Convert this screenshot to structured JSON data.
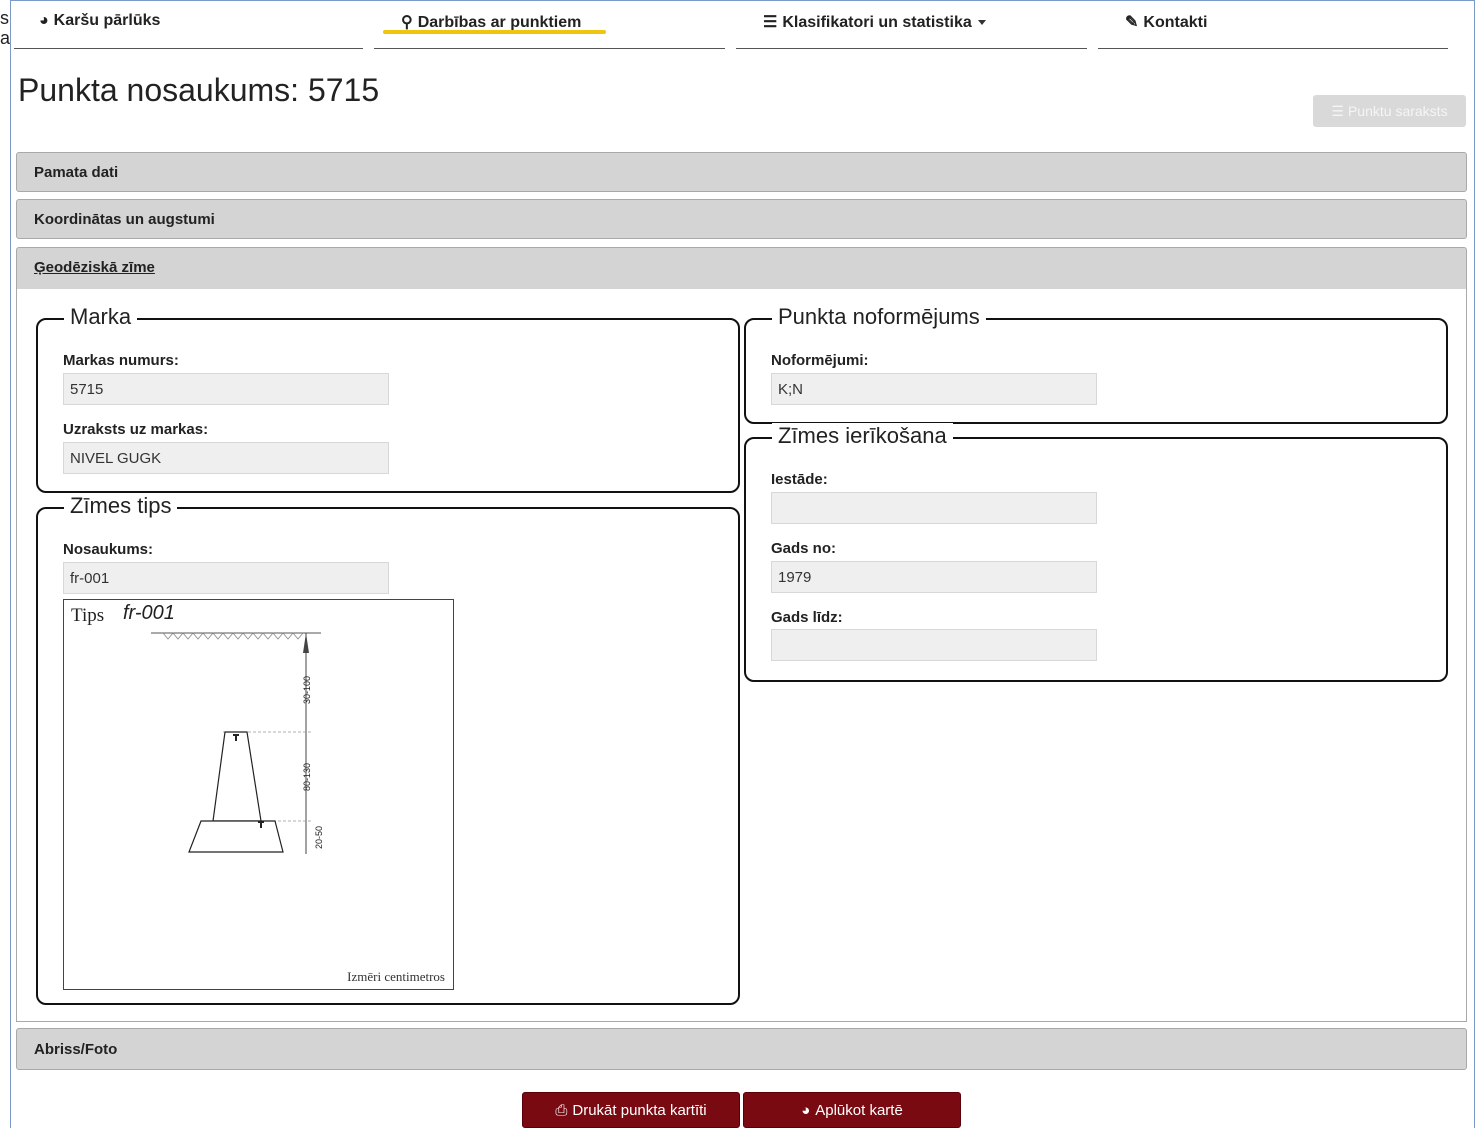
{
  "left_clip": {
    "line1": "s",
    "line2": "a"
  },
  "nav": {
    "items": [
      {
        "icon": "globe-icon",
        "glyph": "◕",
        "label": "Karšu pārlūks"
      },
      {
        "icon": "map-marker-icon",
        "glyph": "⚲",
        "label": "Darbības ar punktiem",
        "active": true
      },
      {
        "icon": "list-icon",
        "glyph": "☰",
        "label": "Klasifikatori un statistika"
      },
      {
        "icon": "edit-icon",
        "glyph": "✎",
        "label": "Kontakti"
      }
    ],
    "active_color": "#f1c40f"
  },
  "page": {
    "title": "Punkta nosaukums: 5715",
    "list_button": {
      "icon": "list-icon",
      "glyph": "☰",
      "label": "Punktu saraksts"
    }
  },
  "panels": [
    {
      "label": "Pamata dati"
    },
    {
      "label": "Koordinātas un augstumi"
    },
    {
      "label": "Ģeodēziskā zīme",
      "open": true
    },
    {
      "label": "Abriss/Foto"
    }
  ],
  "marka": {
    "legend": "Marka",
    "number_label": "Markas numurs:",
    "number_value": "5715",
    "inscription_label": "Uzraksts uz markas:",
    "inscription_value": "NIVEL GUGK"
  },
  "zimes_tips": {
    "legend": "Zīmes tips",
    "name_label": "Nosaukums:",
    "name_value": "fr-001",
    "image": {
      "word_tips": "Tips",
      "type_code": "fr-001",
      "dim_top": "30-100",
      "dim_mid": "80-130",
      "dim_bottom": "20-50",
      "footer": "Izmēri centimetros"
    }
  },
  "noformejums": {
    "legend": "Punkta noformējums",
    "label": "Noformējumi:",
    "value": "K;N"
  },
  "ierikosana": {
    "legend": "Zīmes ierīkošana",
    "institution_label": "Iestāde:",
    "institution_value": "",
    "year_from_label": "Gads no:",
    "year_from_value": "1979",
    "year_to_label": "Gads līdz:",
    "year_to_value": ""
  },
  "actions": {
    "print": {
      "icon": "print-icon",
      "glyph": "⎙",
      "label": "Drukāt punkta kartīti"
    },
    "map": {
      "icon": "globe-icon",
      "glyph": "◕",
      "label": "Aplūkot kartē"
    },
    "color": "#7a0a12"
  }
}
